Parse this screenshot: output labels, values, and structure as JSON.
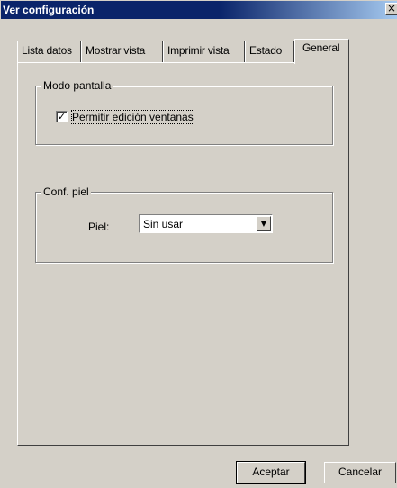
{
  "window": {
    "title": "Ver configuración",
    "close_glyph": "×"
  },
  "tabs": [
    {
      "label": "Lista datos",
      "active": false
    },
    {
      "label": "Mostrar vista",
      "active": false
    },
    {
      "label": "Imprimir vista",
      "active": false
    },
    {
      "label": "Estado",
      "active": false
    },
    {
      "label": "General",
      "active": true
    }
  ],
  "modo_pantalla": {
    "legend": "Modo pantalla",
    "checkbox_label": "Permitir edición ventanas",
    "checked": true,
    "check_glyph": "✓"
  },
  "conf_piel": {
    "legend": "Conf. piel",
    "field_label": "Piel:",
    "selected_value": "Sin usar",
    "arrow_glyph": "▼"
  },
  "buttons": {
    "accept_label": "Aceptar",
    "cancel_label": "Cancelar"
  }
}
